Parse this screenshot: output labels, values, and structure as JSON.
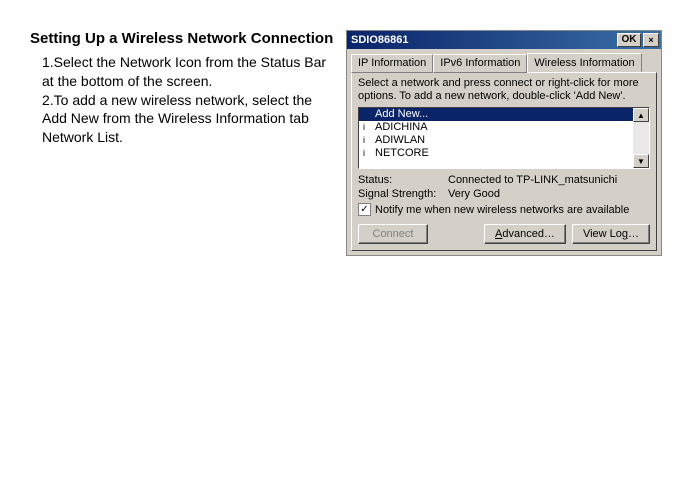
{
  "doc": {
    "heading": "Setting Up a Wireless Network Connection",
    "step1": "1.Select the Network Icon from the Status Bar at the bottom of the screen.",
    "step2": "2.To add a new wireless network, select the Add New from the Wireless Information tab Network List."
  },
  "window": {
    "title": "SDIO86861",
    "ok_label": "OK",
    "close_symbol": "×",
    "tabs": {
      "ip": "IP Information",
      "ipv6": "IPv6 Information",
      "wireless": "Wireless Information"
    },
    "hint": "Select a network and press connect or right-click for more options.  To add a new network, double-click 'Add New'.",
    "networks": [
      {
        "signal": "",
        "name": "Add New..."
      },
      {
        "signal": "i",
        "name": "ADICHINA"
      },
      {
        "signal": "i",
        "name": "ADIWLAN"
      },
      {
        "signal": "i",
        "name": "NETCORE"
      }
    ],
    "scroll_up": "▲",
    "scroll_down": "▼",
    "status": {
      "status_label": "Status:",
      "status_value": "Connected to TP-LINK_matsunichi",
      "signal_label": "Signal Strength:",
      "signal_value": "Very Good"
    },
    "notify_checked": "✓",
    "notify_label": "Notify me when new wireless networks are available",
    "buttons": {
      "connect": "Connect",
      "advanced_u": "A",
      "advanced_rest": "dvanced…",
      "viewlog_pre": "View Lo",
      "viewlog_u": "g",
      "viewlog_post": "…"
    }
  }
}
